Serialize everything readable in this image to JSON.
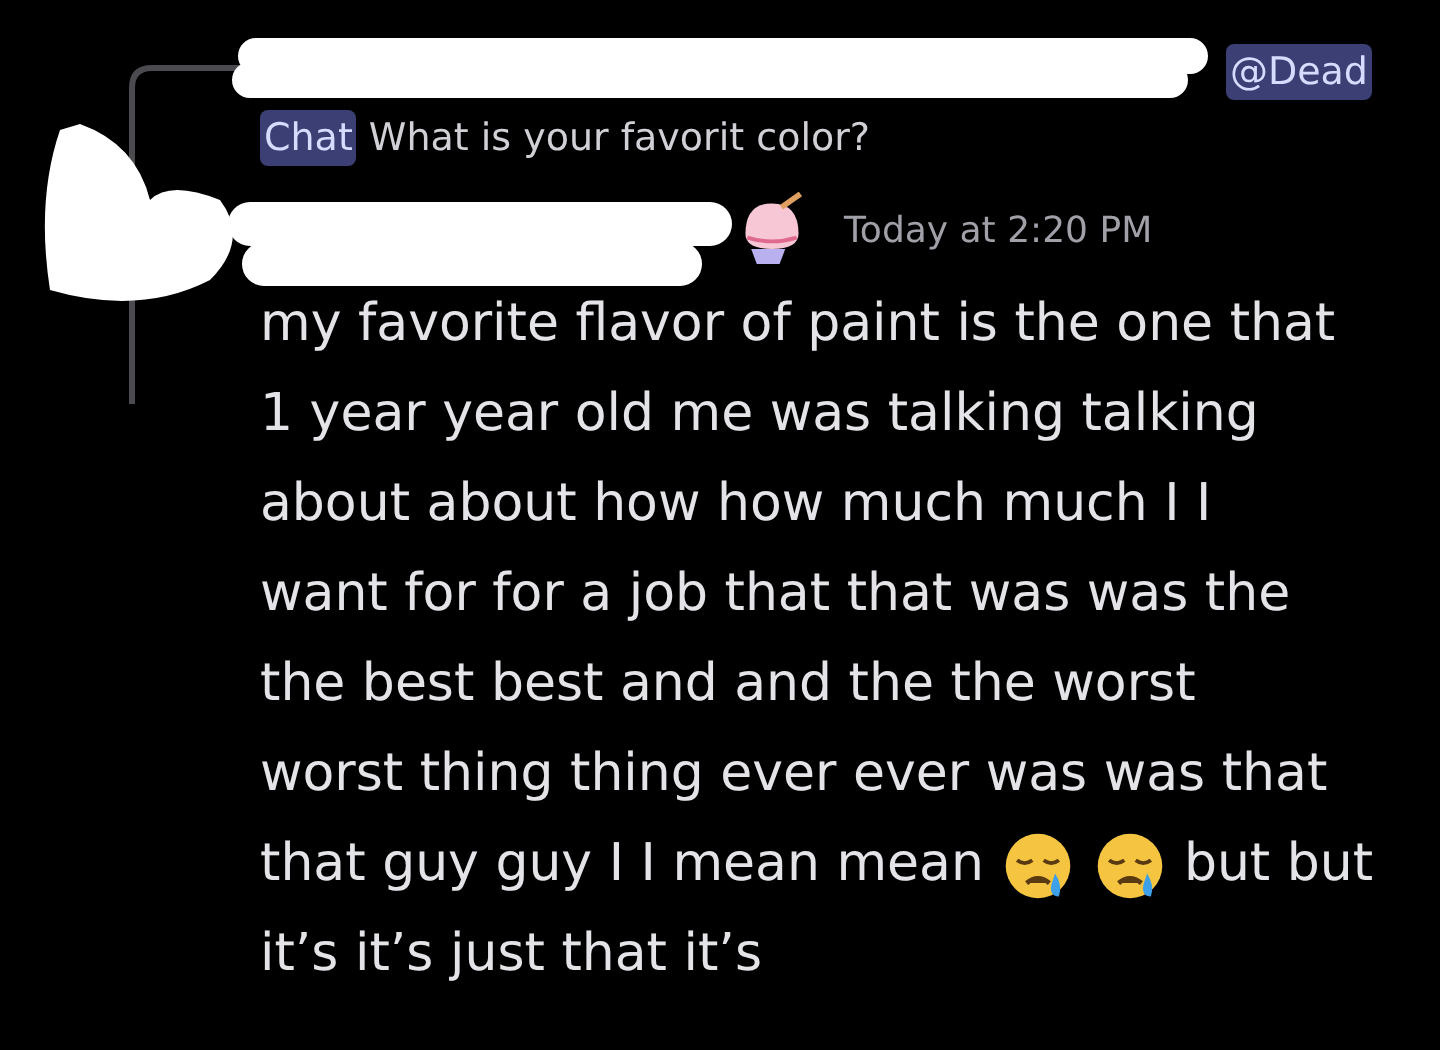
{
  "reply": {
    "mention_line_1": "@Dead",
    "mention_line_2": "Chat",
    "text": "What is your favorit color?"
  },
  "message": {
    "timestamp": "Today at 2:20 PM",
    "lines": [
      [
        {
          "kind": "text",
          "text": "my favorite flavor of paint is the one that"
        }
      ],
      [
        {
          "kind": "text",
          "text": "1 year year old me was talking talking"
        }
      ],
      [
        {
          "kind": "text",
          "text": "about about how how much much I I"
        }
      ],
      [
        {
          "kind": "text",
          "text": "want for for a job that that was was the"
        }
      ],
      [
        {
          "kind": "text",
          "text": "the best best and and the the worst"
        }
      ],
      [
        {
          "kind": "text",
          "text": "worst thing thing ever ever was was that"
        }
      ],
      [
        {
          "kind": "text",
          "text": "that guy guy I I mean mean"
        },
        {
          "kind": "emoji"
        },
        {
          "kind": "emoji"
        },
        {
          "kind": "text",
          "text": "but but"
        }
      ],
      [
        {
          "kind": "text",
          "text": "it’s it’s just that it’s"
        }
      ]
    ]
  }
}
